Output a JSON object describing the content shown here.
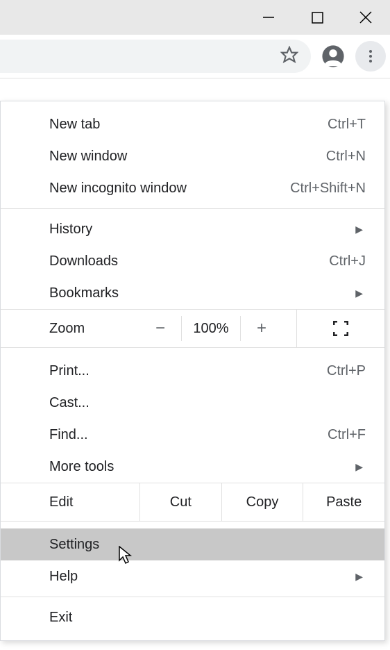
{
  "menu": {
    "new_tab": {
      "label": "New tab",
      "shortcut": "Ctrl+T"
    },
    "new_window": {
      "label": "New window",
      "shortcut": "Ctrl+N"
    },
    "new_incognito": {
      "label": "New incognito window",
      "shortcut": "Ctrl+Shift+N"
    },
    "history": {
      "label": "History"
    },
    "downloads": {
      "label": "Downloads",
      "shortcut": "Ctrl+J"
    },
    "bookmarks": {
      "label": "Bookmarks"
    },
    "zoom": {
      "label": "Zoom",
      "minus": "−",
      "value": "100%",
      "plus": "+"
    },
    "print": {
      "label": "Print...",
      "shortcut": "Ctrl+P"
    },
    "cast": {
      "label": "Cast..."
    },
    "find": {
      "label": "Find...",
      "shortcut": "Ctrl+F"
    },
    "more_tools": {
      "label": "More tools"
    },
    "edit": {
      "label": "Edit",
      "cut": "Cut",
      "copy": "Copy",
      "paste": "Paste"
    },
    "settings": {
      "label": "Settings"
    },
    "help": {
      "label": "Help"
    },
    "exit": {
      "label": "Exit"
    }
  }
}
